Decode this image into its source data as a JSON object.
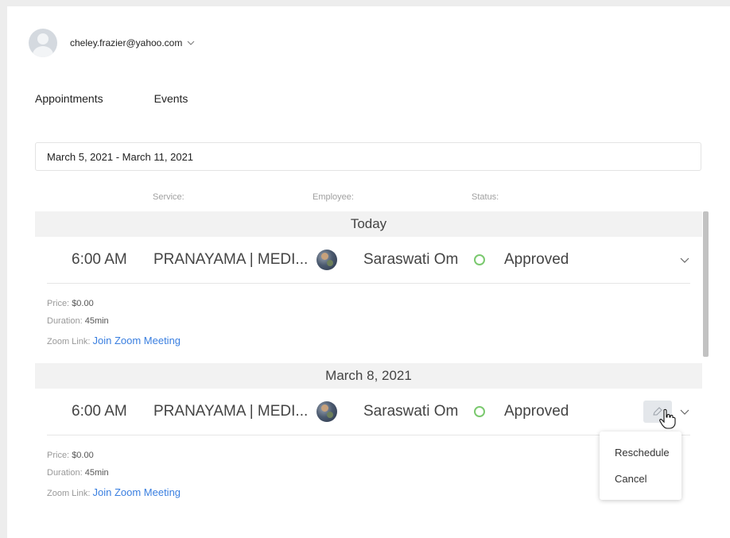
{
  "user": {
    "email": "cheley.frazier@yahoo.com",
    "avatar_icon": "user-avatar-icon",
    "menu_icon": "chevron-down-icon"
  },
  "tabs": [
    {
      "label": "Appointments"
    },
    {
      "label": "Events"
    }
  ],
  "date_range": "March 5, 2021 - March 11, 2021",
  "columns": {
    "service": "Service:",
    "employee": "Employee:",
    "status": "Status:"
  },
  "groups": [
    {
      "day": "Today",
      "appointments": [
        {
          "time": "6:00 AM",
          "service": "PRANAYAMA | MEDI...",
          "employee": "Saraswati Om",
          "status": "Approved",
          "price_label": "Price:",
          "price": "$0.00",
          "duration_label": "Duration:",
          "duration": "45min",
          "zoom_label": "Zoom Link:",
          "zoom_link_text": "Join Zoom Meeting"
        }
      ]
    },
    {
      "day": "March 8, 2021",
      "appointments": [
        {
          "time": "6:00 AM",
          "service": "PRANAYAMA | MEDI...",
          "employee": "Saraswati Om",
          "status": "Approved",
          "price_label": "Price:",
          "price": "$0.00",
          "duration_label": "Duration:",
          "duration": "45min",
          "zoom_label": "Zoom Link:",
          "zoom_link_text": "Join Zoom Meeting"
        }
      ]
    }
  ],
  "actions_menu": {
    "items": [
      "Reschedule",
      "Cancel"
    ]
  },
  "colors": {
    "status_approved": "#7bc96f",
    "link": "#3a7fe0",
    "day_header_bg": "#f2f2f2"
  }
}
